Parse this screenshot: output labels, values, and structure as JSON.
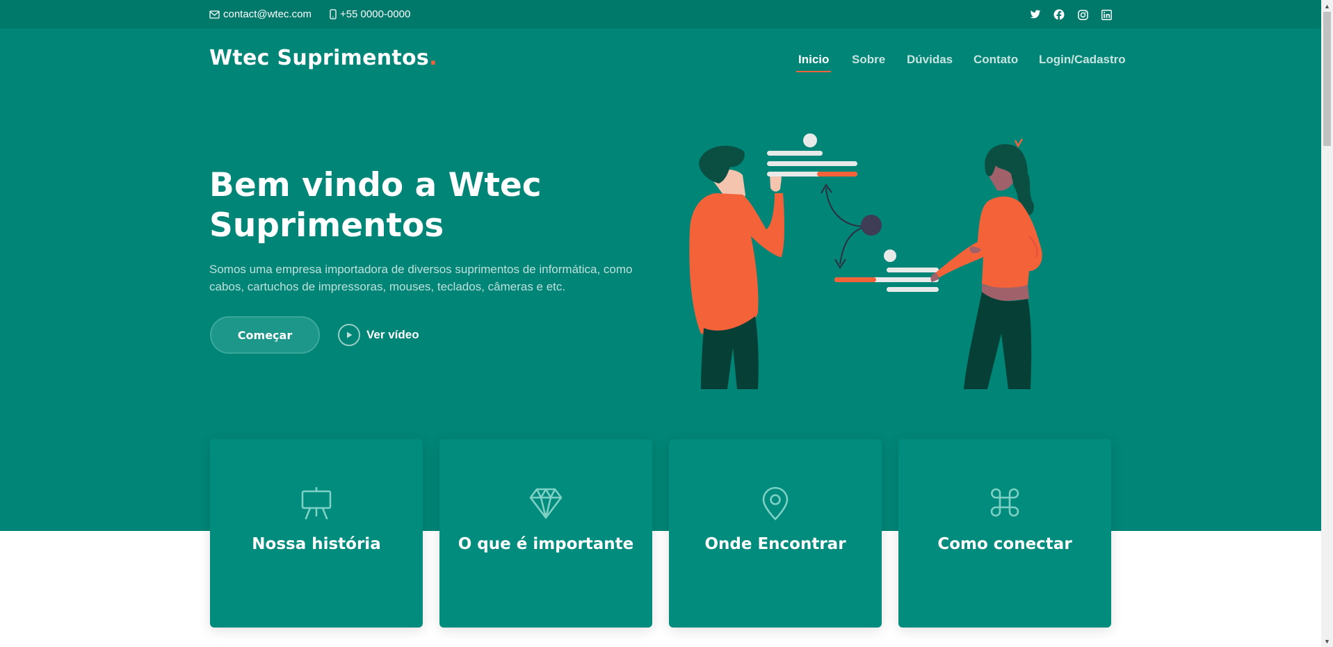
{
  "topbar": {
    "email": "contact@wtec.com",
    "phone": "+55 0000-0000",
    "social": [
      "twitter-icon",
      "facebook-icon",
      "instagram-icon",
      "linkedin-icon"
    ]
  },
  "brand": {
    "name": "Wtec Suprimentos",
    "dot": "."
  },
  "nav": {
    "items": [
      {
        "label": "Inicio",
        "active": true
      },
      {
        "label": "Sobre"
      },
      {
        "label": "Dúvidas"
      },
      {
        "label": "Contato"
      },
      {
        "label": "Login/Cadastro"
      }
    ]
  },
  "hero": {
    "title": "Bem vindo a Wtec Suprimentos",
    "subtitle": "Somos uma empresa importadora de diversos suprimentos de informática, como cabos, cartuchos de impressoras, mouses, teclados, câmeras e etc.",
    "cta_primary": "Começar",
    "cta_video": "Ver vídeo"
  },
  "cards": [
    {
      "icon": "presentation-easel-icon",
      "title": "Nossa história"
    },
    {
      "icon": "gem-icon",
      "title": "O que é importante"
    },
    {
      "icon": "map-pin-icon",
      "title": "Onde Encontrar"
    },
    {
      "icon": "command-icon",
      "title": "Como conectar"
    }
  ],
  "colors": {
    "topbar": "#00796b",
    "hero": "#008576",
    "card": "#018c7d",
    "accent": "#f4623a"
  }
}
